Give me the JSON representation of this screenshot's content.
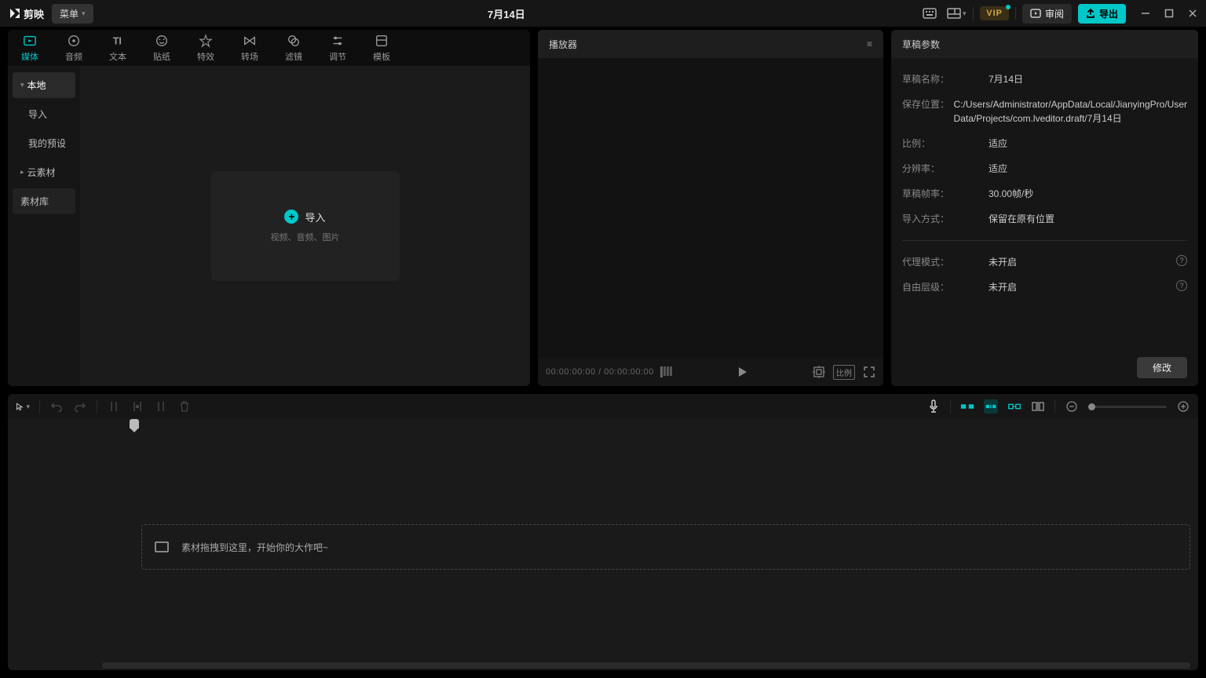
{
  "titlebar": {
    "app_name": "剪映",
    "menu_label": "菜单",
    "project_title": "7月14日",
    "vip_label": "VIP",
    "review_label": "审阅",
    "export_label": "导出"
  },
  "media_tabs": [
    {
      "id": "media",
      "label": "媒体"
    },
    {
      "id": "audio",
      "label": "音频"
    },
    {
      "id": "text",
      "label": "文本"
    },
    {
      "id": "sticker",
      "label": "贴纸"
    },
    {
      "id": "effect",
      "label": "特效"
    },
    {
      "id": "transition",
      "label": "转场"
    },
    {
      "id": "filter",
      "label": "滤镜"
    },
    {
      "id": "adjust",
      "label": "调节"
    },
    {
      "id": "template",
      "label": "模板"
    }
  ],
  "side_nav": [
    {
      "label": "本地",
      "active": true,
      "parent": true
    },
    {
      "label": "导入",
      "active": false,
      "parent": false
    },
    {
      "label": "我的预设",
      "active": false,
      "parent": false
    },
    {
      "label": "云素材",
      "active": false,
      "parent": true
    },
    {
      "label": "素材库",
      "active": false,
      "parent": false
    }
  ],
  "import": {
    "label": "导入",
    "subtitle": "视频、音频、图片"
  },
  "player": {
    "title": "播放器",
    "time_current": "00:00:00:00",
    "time_total": "00:00:00:00",
    "ratio_label": "比例"
  },
  "draft": {
    "title": "草稿参数",
    "rows": {
      "name_label": "草稿名称：",
      "name_value": "7月14日",
      "path_label": "保存位置：",
      "path_value": "C:/Users/Administrator/AppData/Local/JianyingPro/User Data/Projects/com.lveditor.draft/7月14日",
      "ratio_label": "比例：",
      "ratio_value": "适应",
      "res_label": "分辨率：",
      "res_value": "适应",
      "fps_label": "草稿帧率：",
      "fps_value": "30.00帧/秒",
      "import_label": "导入方式：",
      "import_value": "保留在原有位置",
      "proxy_label": "代理模式：",
      "proxy_value": "未开启",
      "free_label": "自由层级：",
      "free_value": "未开启"
    },
    "modify_label": "修改"
  },
  "timeline": {
    "drop_hint": "素材拖拽到这里，开始你的大作吧~"
  }
}
